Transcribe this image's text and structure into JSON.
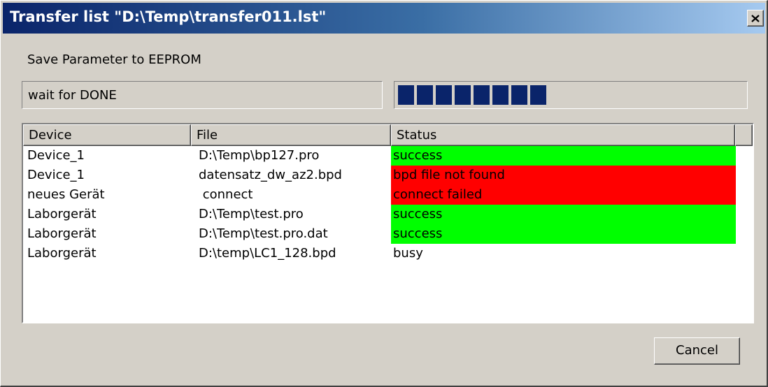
{
  "window": {
    "title": "Transfer list \"D:\\Temp\\transfer011.lst\""
  },
  "operation": {
    "label": "Save Parameter to EEPROM",
    "status": "wait for DONE",
    "progress_blocks": 8,
    "progress_color": "#0a246a"
  },
  "table": {
    "columns": [
      "Device",
      "File",
      "Status"
    ],
    "rows": [
      {
        "device": "Device_1",
        "file": "D:\\Temp\\bp127.pro",
        "status": "success",
        "status_color": "#00ff00"
      },
      {
        "device": "Device_1",
        "file": "datensatz_dw_az2.bpd",
        "status": "bpd file not found",
        "status_color": "#ff0000"
      },
      {
        "device": "neues Gerät",
        "file": " connect",
        "status": "connect failed",
        "status_color": "#ff0000"
      },
      {
        "device": "Laborgerät",
        "file": "D:\\Temp\\test.pro",
        "status": "success",
        "status_color": "#00ff00"
      },
      {
        "device": "Laborgerät",
        "file": "D:\\Temp\\test.pro.dat",
        "status": "success",
        "status_color": "#00ff00"
      },
      {
        "device": "Laborgerät",
        "file": "D:\\temp\\LC1_128.bpd",
        "status": "busy",
        "status_color": ""
      }
    ]
  },
  "buttons": {
    "cancel_label": "Cancel"
  },
  "icons": {
    "close": "close-icon"
  }
}
